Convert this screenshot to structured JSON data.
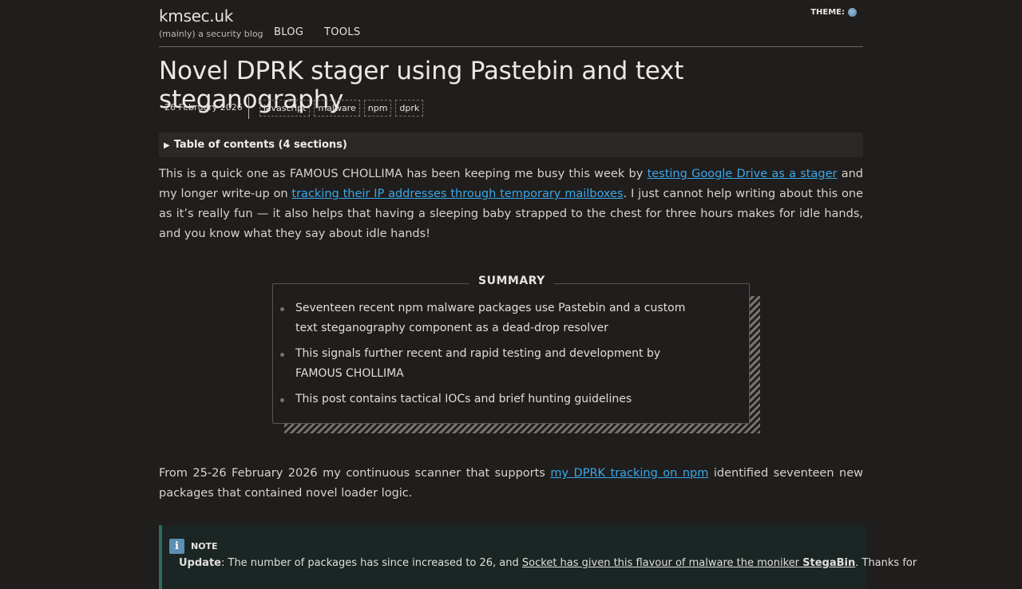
{
  "header": {
    "site_title": "kmsec.uk",
    "site_subtitle": "(mainly) a security blog",
    "nav": [
      "BLOG",
      "TOOLS"
    ],
    "theme_label": "THEME:",
    "theme_icon": "globe-icon"
  },
  "post": {
    "title": "Novel DPRK stager using Pastebin and text steganography",
    "date": "26 February 2026",
    "tags": [
      "javascript",
      "malware",
      "npm",
      "dprk"
    ],
    "toc_label": "Table of contents (4 sections)",
    "intro": {
      "t1": "This is a quick one as FAMOUS CHOLLIMA has been keeping me busy this week by ",
      "link1": "testing Google Drive as a stager",
      "t2": " and my longer write-up on ",
      "link2": "tracking their IP addresses through temporary mailboxes",
      "t3": ". I just cannot help writing about this one as it’s really fun — it also helps that having a sleeping baby strapped to the chest for three hours makes for idle hands, and you know what they say about idle hands!"
    },
    "summary": {
      "title": "SUMMARY",
      "items": [
        "Seventeen recent npm malware packages use Pastebin and a custom text steganography component as a dead-drop resolver",
        "This signals further recent and rapid testing and development by FAMOUS CHOLLIMA",
        "This post contains tactical IOCs and brief hunting guidelines"
      ]
    },
    "para2": {
      "t1": "From 25-26 February 2026 my continuous scanner that supports ",
      "link": "my DPRK tracking on npm",
      "t2": " identified seventeen new packages that contained novel loader logic."
    },
    "note": {
      "label": "NOTE",
      "icon": "info-icon",
      "update_label": "Update",
      "t1": ": The number of packages has since increased to 26, and ",
      "link": "Socket has given this flavour of malware the moniker",
      "bold": "StegaBin",
      "t2": ". Thanks for"
    }
  }
}
